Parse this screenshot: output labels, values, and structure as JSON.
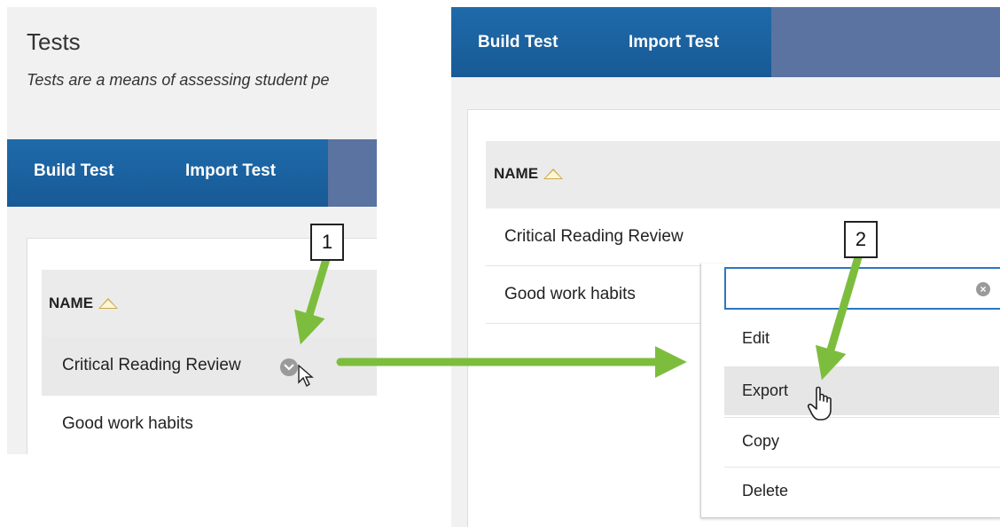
{
  "left": {
    "page_title": "Tests",
    "page_subtitle": "Tests are a means of assessing student pe",
    "tabs": [
      {
        "label": "Build Test"
      },
      {
        "label": "Import Test"
      }
    ],
    "table": {
      "column_header": "NAME",
      "rows": [
        "Critical Reading Review",
        "Good work habits"
      ]
    }
  },
  "right": {
    "tabs": [
      {
        "label": "Build Test"
      },
      {
        "label": "Import Test"
      }
    ],
    "table": {
      "column_header": "NAME",
      "rows": [
        "Critical Reading Review",
        "Good work habits"
      ]
    },
    "menu": {
      "search_value": "",
      "clear_icon": "×",
      "items": [
        "Edit",
        "Export",
        "Copy",
        "Delete"
      ]
    }
  },
  "callouts": [
    "1",
    "2"
  ],
  "colors": {
    "actionbar": "#1f6aaa",
    "actionbar_spacer": "#5a73a0",
    "annotation_arrow": "#7dbd3d",
    "focus_border": "#2a78c2"
  }
}
